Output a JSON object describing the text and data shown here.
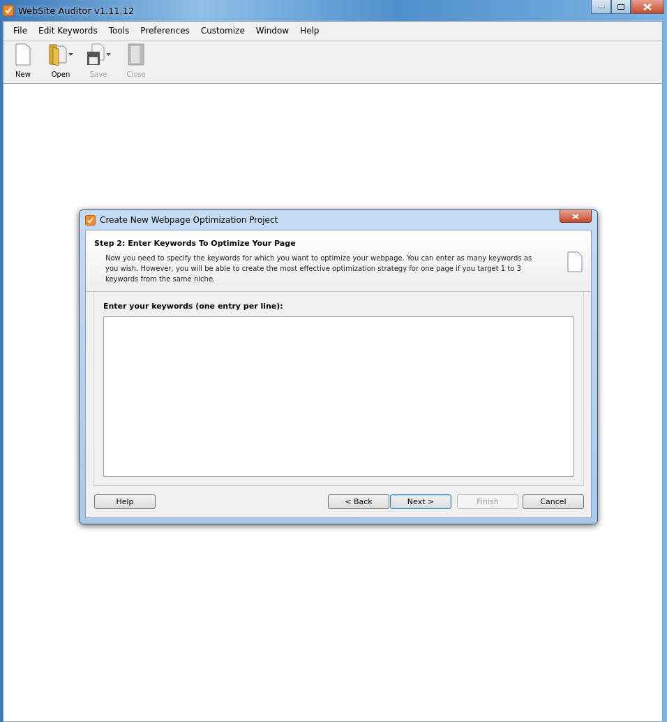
{
  "window": {
    "title": "WebSite Auditor v1.11.12"
  },
  "menu": [
    "File",
    "Edit Keywords",
    "Tools",
    "Preferences",
    "Customize",
    "Window",
    "Help"
  ],
  "toolbar": [
    {
      "label": "New",
      "kind": "new",
      "disabled": false,
      "dropdown": false
    },
    {
      "label": "Open",
      "kind": "open",
      "disabled": false,
      "dropdown": true
    },
    {
      "label": "Save",
      "kind": "save",
      "disabled": true,
      "dropdown": true
    },
    {
      "label": "Close",
      "kind": "close",
      "disabled": true,
      "dropdown": false
    }
  ],
  "dialog": {
    "title": "Create New Webpage Optimization Project",
    "step_title": "Step 2: Enter Keywords To Optimize Your Page",
    "description": "Now you need to specify the keywords for which you want to optimize your webpage. You can enter as many keywords as you wish. However, you will be able to create the most effective optimization strategy for one page if you target 1 to 3 keywords from the same niche.",
    "field_label": "Enter your keywords (one entry per line):",
    "buttons": [
      {
        "label": "Help",
        "disabled": false,
        "default": false
      },
      {
        "label": "< Back",
        "disabled": false,
        "default": false
      },
      {
        "label": "Next >",
        "disabled": false,
        "default": true
      },
      {
        "label": "Finish",
        "disabled": true,
        "default": false
      },
      {
        "label": "Cancel",
        "disabled": false,
        "default": false
      }
    ]
  }
}
